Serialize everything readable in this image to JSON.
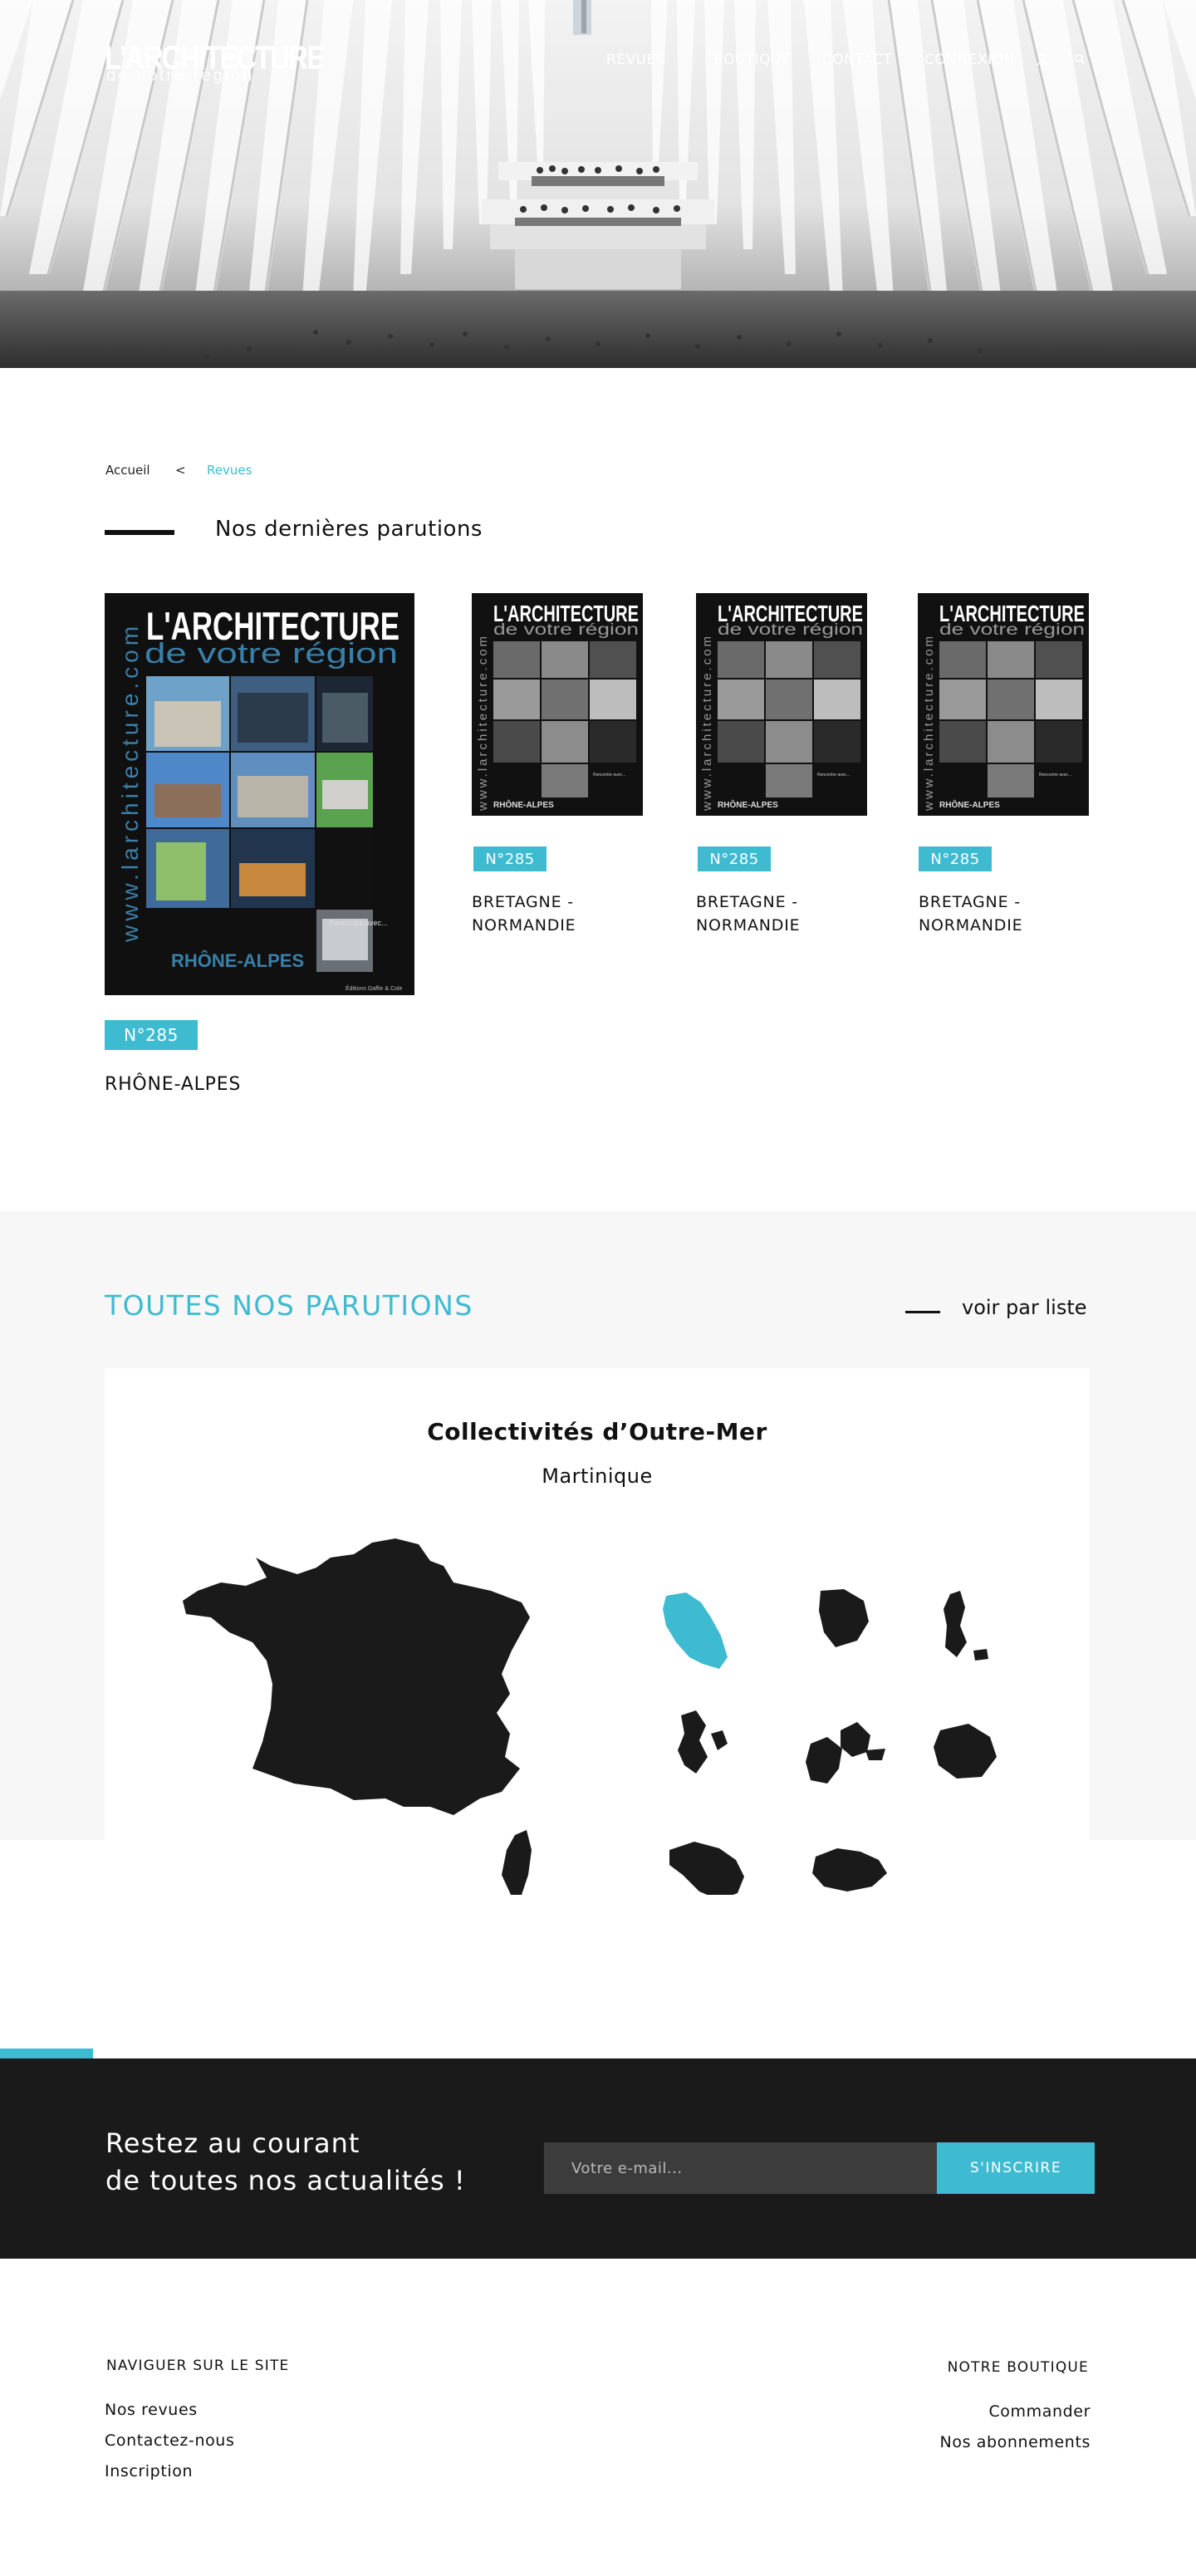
{
  "logo": {
    "main": "L'ARCHITECTURE",
    "sub": "de votre région"
  },
  "nav": {
    "items": [
      "REVUES",
      "BOUTIQUE",
      "CONTACT",
      "CONNEXION"
    ],
    "icons": [
      "user-icon",
      "search-icon"
    ]
  },
  "breadcrumb": {
    "home": "Accueil",
    "separator": "<",
    "current": "Revues"
  },
  "latest": {
    "title": "Nos dernières parutions",
    "issues": [
      {
        "badge": "N°285",
        "region": "RHÔNE-ALPES"
      },
      {
        "badge": "N°285",
        "region": "BRETAGNE - NORMANDIE"
      },
      {
        "badge": "N°285",
        "region": "BRETAGNE - NORMANDIE"
      },
      {
        "badge": "N°285",
        "region": "BRETAGNE - NORMANDIE"
      }
    ],
    "cover_texts": {
      "brand": "L'ARCHITECTURE",
      "sub": "de votre région",
      "site": "www.larchitecture.com",
      "region_main": "RHÔNE-ALPES",
      "region_small": "RHÔNE-ALPES",
      "meet": "Rencontre avec...",
      "publisher": "Éditions Gaffie & Cole"
    }
  },
  "all": {
    "title": "TOUTES NOS PARUTIONS",
    "list_link": "voir par liste",
    "map_title": "Collectivités d’Outre-Mer",
    "map_subtitle": "Martinique"
  },
  "colors": {
    "accent": "#3ebbd0",
    "dark": "#1a1a1a",
    "grey_band": "#f7f7f7"
  },
  "newsletter": {
    "line1": "Restez au courant",
    "line2": "de toutes nos actualités !",
    "placeholder": "Votre e-mail...",
    "button": "S'INSCRIRE"
  },
  "footer": {
    "left_heading": "NAVIGUER SUR LE SITE",
    "left_links": [
      "Nos revues",
      "Contactez-nous",
      "Inscription"
    ],
    "right_heading": "NOTRE BOUTIQUE",
    "right_links": [
      "Commander",
      "Nos abonnements"
    ]
  }
}
